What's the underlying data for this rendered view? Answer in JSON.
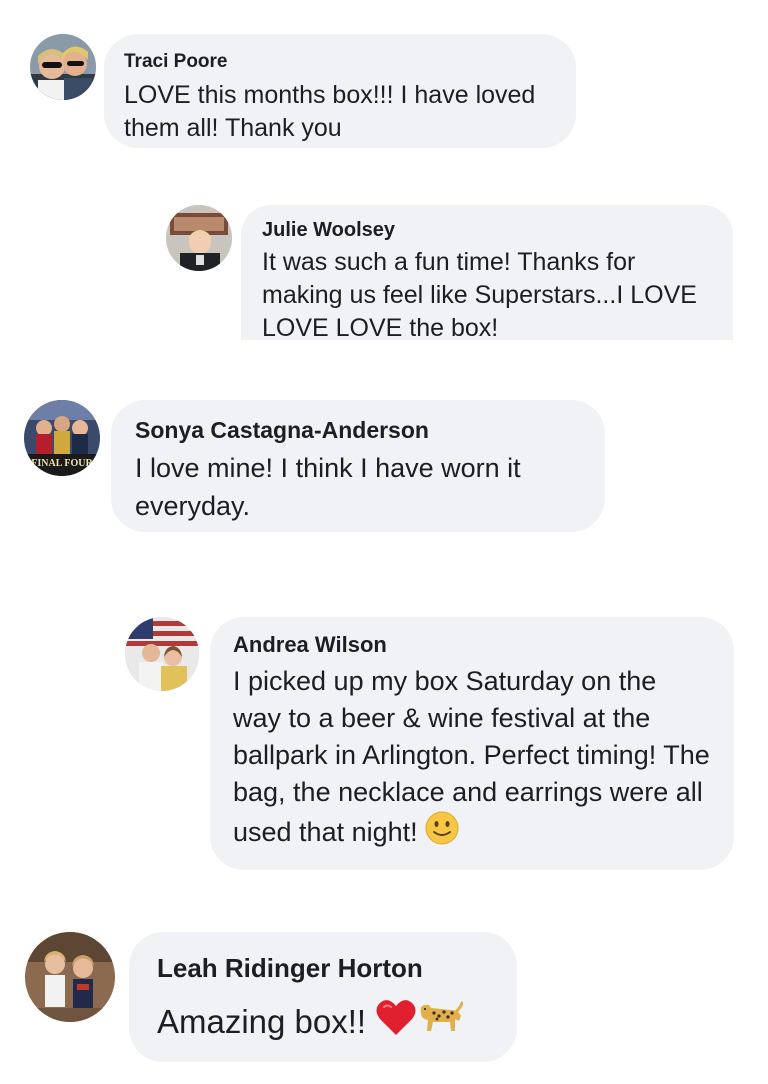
{
  "comments": [
    {
      "author": "Traci Poore",
      "text": "LOVE this months box!!! I have loved them all! Thank you",
      "avatar_icon": "profile-photo"
    },
    {
      "author": "Julie Woolsey",
      "text": "It was such a fun time! Thanks for making us feel like Superstars...I LOVE LOVE LOVE the box!",
      "avatar_icon": "profile-photo"
    },
    {
      "author": "Sonya Castagna-Anderson",
      "text": "I love mine!  I think I have worn it everyday.",
      "avatar_icon": "profile-photo",
      "avatar_caption": "FINAL FOUR"
    },
    {
      "author": "Andrea Wilson",
      "text": "I picked up my box Saturday on the way to a beer & wine festival at the ballpark in Arlington. Perfect timing! The bag, the necklace and earrings were all used that night!",
      "emoji": "slightly-smiling-face",
      "avatar_icon": "profile-photo"
    },
    {
      "author": "Leah Ridinger Horton",
      "text": "Amazing box!!",
      "emoji": [
        "red-heart",
        "leopard"
      ],
      "avatar_icon": "profile-photo"
    }
  ],
  "colors": {
    "bubble_background": "#f0f2f5",
    "text": "#1c1e21",
    "page_background": "#ffffff"
  }
}
